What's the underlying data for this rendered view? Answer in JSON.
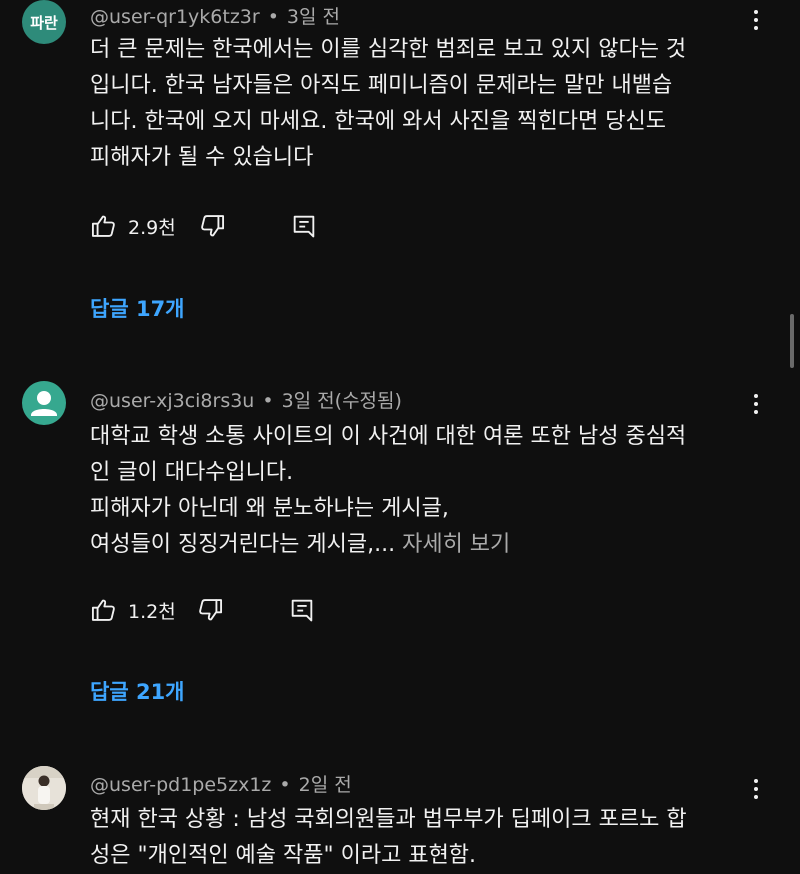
{
  "comments": [
    {
      "avatar_text": "파란",
      "avatar_color": "#2e8b7a",
      "username": "@user-qr1yk6tz3r",
      "time": "3일 전",
      "lines": [
        "더 큰 문제는 한국에서는 이를 심각한 범죄로 보고 있지 않다는 것",
        "입니다. 한국 남자들은 아직도 페미니즘이 문제라는 말만 내뱉습",
        "니다. 한국에 오지 마세요. 한국에 와서 사진을 찍힌다면 당신도",
        "피해자가 될 수 있습니다"
      ],
      "like_count": "2.9천",
      "replies_label": "답글 17개"
    },
    {
      "avatar_color": "#36a88f",
      "username": "@user-xj3ci8rs3u",
      "time": "3일 전(수정됨)",
      "lines": [
        "대학교 학생 소통 사이트의 이 사건에 대한 여론 또한 남성 중심적",
        "인 글이 대다수입니다.",
        "피해자가 아닌데 왜 분노하냐는 게시글,",
        "여성들이 징징거린다는 게시글,..."
      ],
      "read_more": "자세히 보기",
      "like_count": "1.2천",
      "replies_label": "답글 21개"
    },
    {
      "username": "@user-pd1pe5zx1z",
      "time": "2일 전",
      "lines": [
        "현재 한국 상황 : 남성 국회의원들과 법무부가 딥페이크 포르노 합",
        "성은 \"개인적인 예술 작품\" 이라고 표현함."
      ]
    }
  ]
}
